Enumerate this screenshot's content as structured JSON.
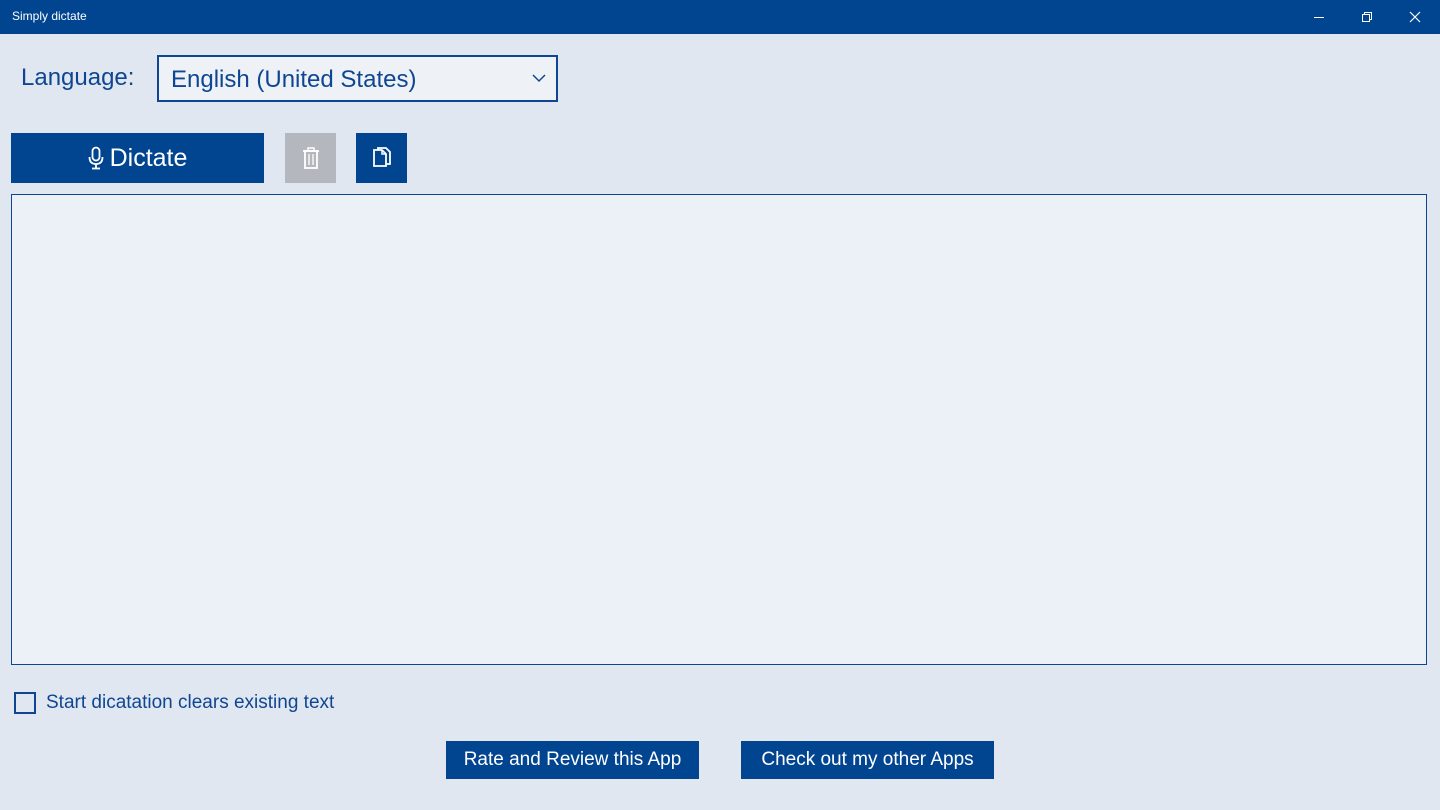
{
  "window": {
    "title": "Simply dictate",
    "controls": [
      "minimize-icon",
      "restore-icon",
      "close-icon"
    ]
  },
  "language": {
    "label": "Language:",
    "selected": "English (United States)"
  },
  "toolbar": {
    "dictate_label": "Dictate",
    "dictate_icon": "microphone-icon",
    "delete_icon": "trash-icon",
    "delete_enabled": false,
    "copy_icon": "copy-icon"
  },
  "editor": {
    "text": ""
  },
  "options": {
    "clear_on_start_label": "Start dicatation clears existing text",
    "clear_on_start_checked": false
  },
  "footer": {
    "rate_label": "Rate and Review this App",
    "other_apps_label": "Check out my other Apps"
  },
  "colors": {
    "accent": "#014591",
    "background": "#e1e7f0",
    "disabled": "#b4b8be"
  }
}
